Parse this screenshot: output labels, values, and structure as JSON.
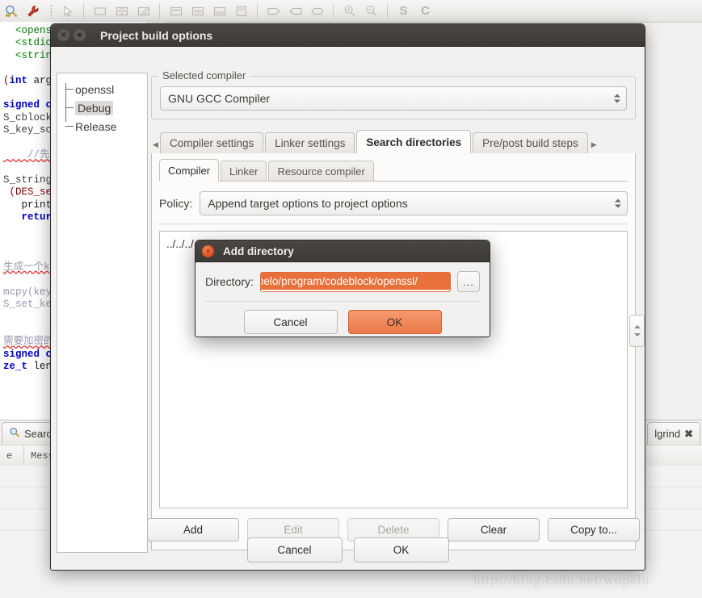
{
  "toolbar": {
    "icons": [
      {
        "name": "zoom-tool-icon"
      },
      {
        "name": "wrench-tool-icon"
      },
      {
        "name": "pointer-tool-icon"
      },
      {
        "name": "rectangle-tool-icon"
      },
      {
        "name": "split-horizontal-icon"
      },
      {
        "name": "skew-tool-icon"
      },
      {
        "name": "align-top-icon"
      },
      {
        "name": "align-middle-icon"
      },
      {
        "name": "align-bottom-icon"
      },
      {
        "name": "panel-icon"
      },
      {
        "name": "arrow-right-box-icon"
      },
      {
        "name": "arrow-left-box-icon"
      },
      {
        "name": "ellipse-box-icon"
      },
      {
        "name": "zoom-in-icon"
      },
      {
        "name": "zoom-out-icon"
      },
      {
        "name": "symbol-s-icon"
      },
      {
        "name": "symbol-c-icon"
      }
    ],
    "symbol_s": "S",
    "symbol_c": "C"
  },
  "editor": {
    "lines": [
      {
        "t": "inc",
        "text": "<openssl"
      },
      {
        "t": "inc",
        "text": "<stdio."
      },
      {
        "t": "inc",
        "text": "<string"
      },
      {
        "t": "blank",
        "text": " "
      },
      {
        "t": "sig",
        "text": "(int arg"
      },
      {
        "t": "blank",
        "text": " "
      },
      {
        "t": "kw",
        "text": "signed c"
      },
      {
        "t": "id",
        "text": "S_cblock"
      },
      {
        "t": "id",
        "text": "S_key_sc"
      },
      {
        "t": "blank",
        "text": " "
      },
      {
        "t": "cm",
        "text": "    //先后"
      },
      {
        "t": "blank",
        "text": " "
      },
      {
        "t": "id",
        "text": "S_string"
      },
      {
        "t": "fn",
        "text": " (DES_se"
      },
      {
        "t": "pl",
        "text": "   printf"
      },
      {
        "t": "kw2",
        "text": "   return"
      },
      {
        "t": "blank",
        "text": " "
      },
      {
        "t": "blank",
        "text": " "
      },
      {
        "t": "blank",
        "text": " "
      },
      {
        "t": "cm2",
        "text": "生成一个k"
      },
      {
        "t": "blank",
        "text": " "
      },
      {
        "t": "fn2",
        "text": "mcpy(key"
      },
      {
        "t": "id2",
        "text": "S_set_ke"
      },
      {
        "t": "blank",
        "text": " "
      },
      {
        "t": "blank",
        "text": " "
      },
      {
        "t": "cm3",
        "text": "需要加密的"
      },
      {
        "t": "kw",
        "text": "signed c"
      },
      {
        "t": "kw3",
        "text": "ze_t len"
      }
    ]
  },
  "bottom_panel": {
    "left_tab": {
      "label": "Search",
      "icon": "search-icon"
    },
    "right_tab": {
      "label": "lgrind",
      "close_icon": "close-icon"
    },
    "columns": [
      "e",
      "Messa"
    ]
  },
  "watermark": "http://blog.csdn.net/wopelo",
  "project_build_options": {
    "title": "Project build options",
    "window_buttons": {
      "close": "×",
      "maximize": "□"
    },
    "tree": [
      {
        "label": "openssl",
        "selected": false
      },
      {
        "label": "Debug",
        "selected": true
      },
      {
        "label": "Release",
        "selected": false
      }
    ],
    "selected_compiler": {
      "group_label": "Selected compiler",
      "value": "GNU GCC Compiler"
    },
    "tabs": [
      {
        "label": "Compiler settings",
        "active": false
      },
      {
        "label": "Linker settings",
        "active": false
      },
      {
        "label": "Search directories",
        "active": true
      },
      {
        "label": "Pre/post build steps",
        "active": false
      }
    ],
    "tab_scroll_left": "◀",
    "tab_scroll_right": "▶",
    "sub_tabs": [
      {
        "label": "Compiler",
        "active": true
      },
      {
        "label": "Linker",
        "active": false
      },
      {
        "label": "Resource compiler",
        "active": false
      }
    ],
    "policy": {
      "label": "Policy:",
      "value": "Append target options to project options"
    },
    "directories": [
      "../../../../../usr/lib/ssl"
    ],
    "list_buttons": [
      {
        "label": "Add",
        "enabled": true
      },
      {
        "label": "Edit",
        "enabled": false
      },
      {
        "label": "Delete",
        "enabled": false
      },
      {
        "label": "Clear",
        "enabled": true
      },
      {
        "label": "Copy to...",
        "enabled": true
      }
    ],
    "footer_buttons": [
      {
        "label": "Cancel"
      },
      {
        "label": "OK"
      }
    ]
  },
  "add_directory_dialog": {
    "title": "Add directory",
    "close_label": "×",
    "field_label": "Directory:",
    "field_value": "pelo/program/codeblock/openssl/",
    "browse_label": "...",
    "buttons": [
      {
        "label": "Cancel",
        "accent": false
      },
      {
        "label": "OK",
        "accent": true
      }
    ]
  },
  "colors": {
    "accent": "#e8703a",
    "titlebar": "#3c3936",
    "window_bg": "#f2f1f0"
  }
}
